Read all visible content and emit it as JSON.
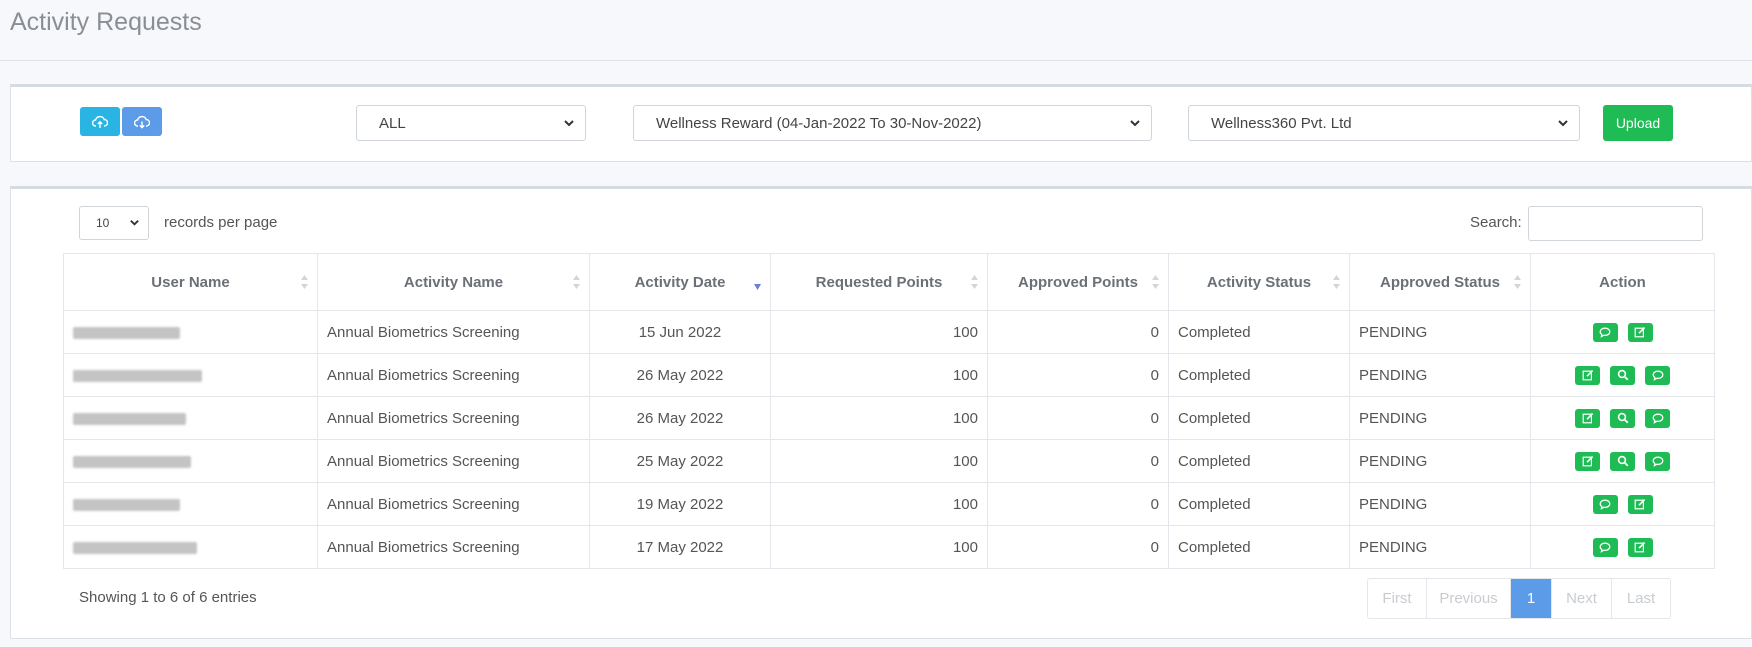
{
  "page": {
    "title": "Activity Requests"
  },
  "filters": {
    "upload_icon": "cloud-upload-icon",
    "download_icon": "cloud-download-icon",
    "type_select": "ALL",
    "program_select": "Wellness Reward (04-Jan-2022 To 30-Nov-2022)",
    "company_select": "Wellness360 Pvt. Ltd",
    "upload_label": "Upload"
  },
  "table_controls": {
    "records_per_page": "10",
    "records_label": "records per page",
    "search_label": "Search:",
    "search_value": ""
  },
  "table": {
    "columns": [
      "User Name",
      "Activity Name",
      "Activity Date",
      "Requested Points",
      "Approved Points",
      "Activity Status",
      "Approved Status",
      "Action"
    ],
    "rows": [
      {
        "user_name": "Lily Mills",
        "activity_name": "Annual Biometrics Screening",
        "activity_date": "15 Jun 2022",
        "requested_points": "100",
        "approved_points": "0",
        "activity_status": "Completed",
        "approved_status": "PENDING",
        "actions": [
          "comment",
          "edit"
        ]
      },
      {
        "user_name": "Amit CHAUDHARY",
        "activity_name": "Annual Biometrics Screening",
        "activity_date": "26 May 2022",
        "requested_points": "100",
        "approved_points": "0",
        "activity_status": "Completed",
        "approved_status": "PENDING",
        "actions": [
          "edit",
          "search",
          "comment"
        ]
      },
      {
        "user_name": "Nitin Rawat",
        "activity_name": "Annual Biometrics Screening",
        "activity_date": "26 May 2022",
        "requested_points": "100",
        "approved_points": "0",
        "activity_status": "Completed",
        "approved_status": "PENDING",
        "actions": [
          "edit",
          "search",
          "comment"
        ]
      },
      {
        "user_name": "Rajeev Kumar",
        "activity_name": "Annual Biometrics Screening",
        "activity_date": "25 May 2022",
        "requested_points": "100",
        "approved_points": "0",
        "activity_status": "Completed",
        "approved_status": "PENDING",
        "actions": [
          "edit",
          "search",
          "comment"
        ]
      },
      {
        "user_name": "Aaron Ross",
        "activity_name": "Annual Biometrics Screening",
        "activity_date": "19 May 2022",
        "requested_points": "100",
        "approved_points": "0",
        "activity_status": "Completed",
        "approved_status": "PENDING",
        "actions": [
          "comment",
          "edit"
        ]
      },
      {
        "user_name": "Gilbert Acuna",
        "activity_name": "Annual Biometrics Screening",
        "activity_date": "17 May 2022",
        "requested_points": "100",
        "approved_points": "0",
        "activity_status": "Completed",
        "approved_status": "PENDING",
        "actions": [
          "comment",
          "edit"
        ]
      }
    ]
  },
  "footer": {
    "info": "Showing 1 to 6 of 6 entries",
    "pagination": [
      "First",
      "Previous",
      "1",
      "Next",
      "Last"
    ],
    "active_page": "1"
  },
  "colors": {
    "accent_green": "#1fbc55",
    "cyan": "#2ab4e4",
    "blue": "#5b9be8"
  }
}
